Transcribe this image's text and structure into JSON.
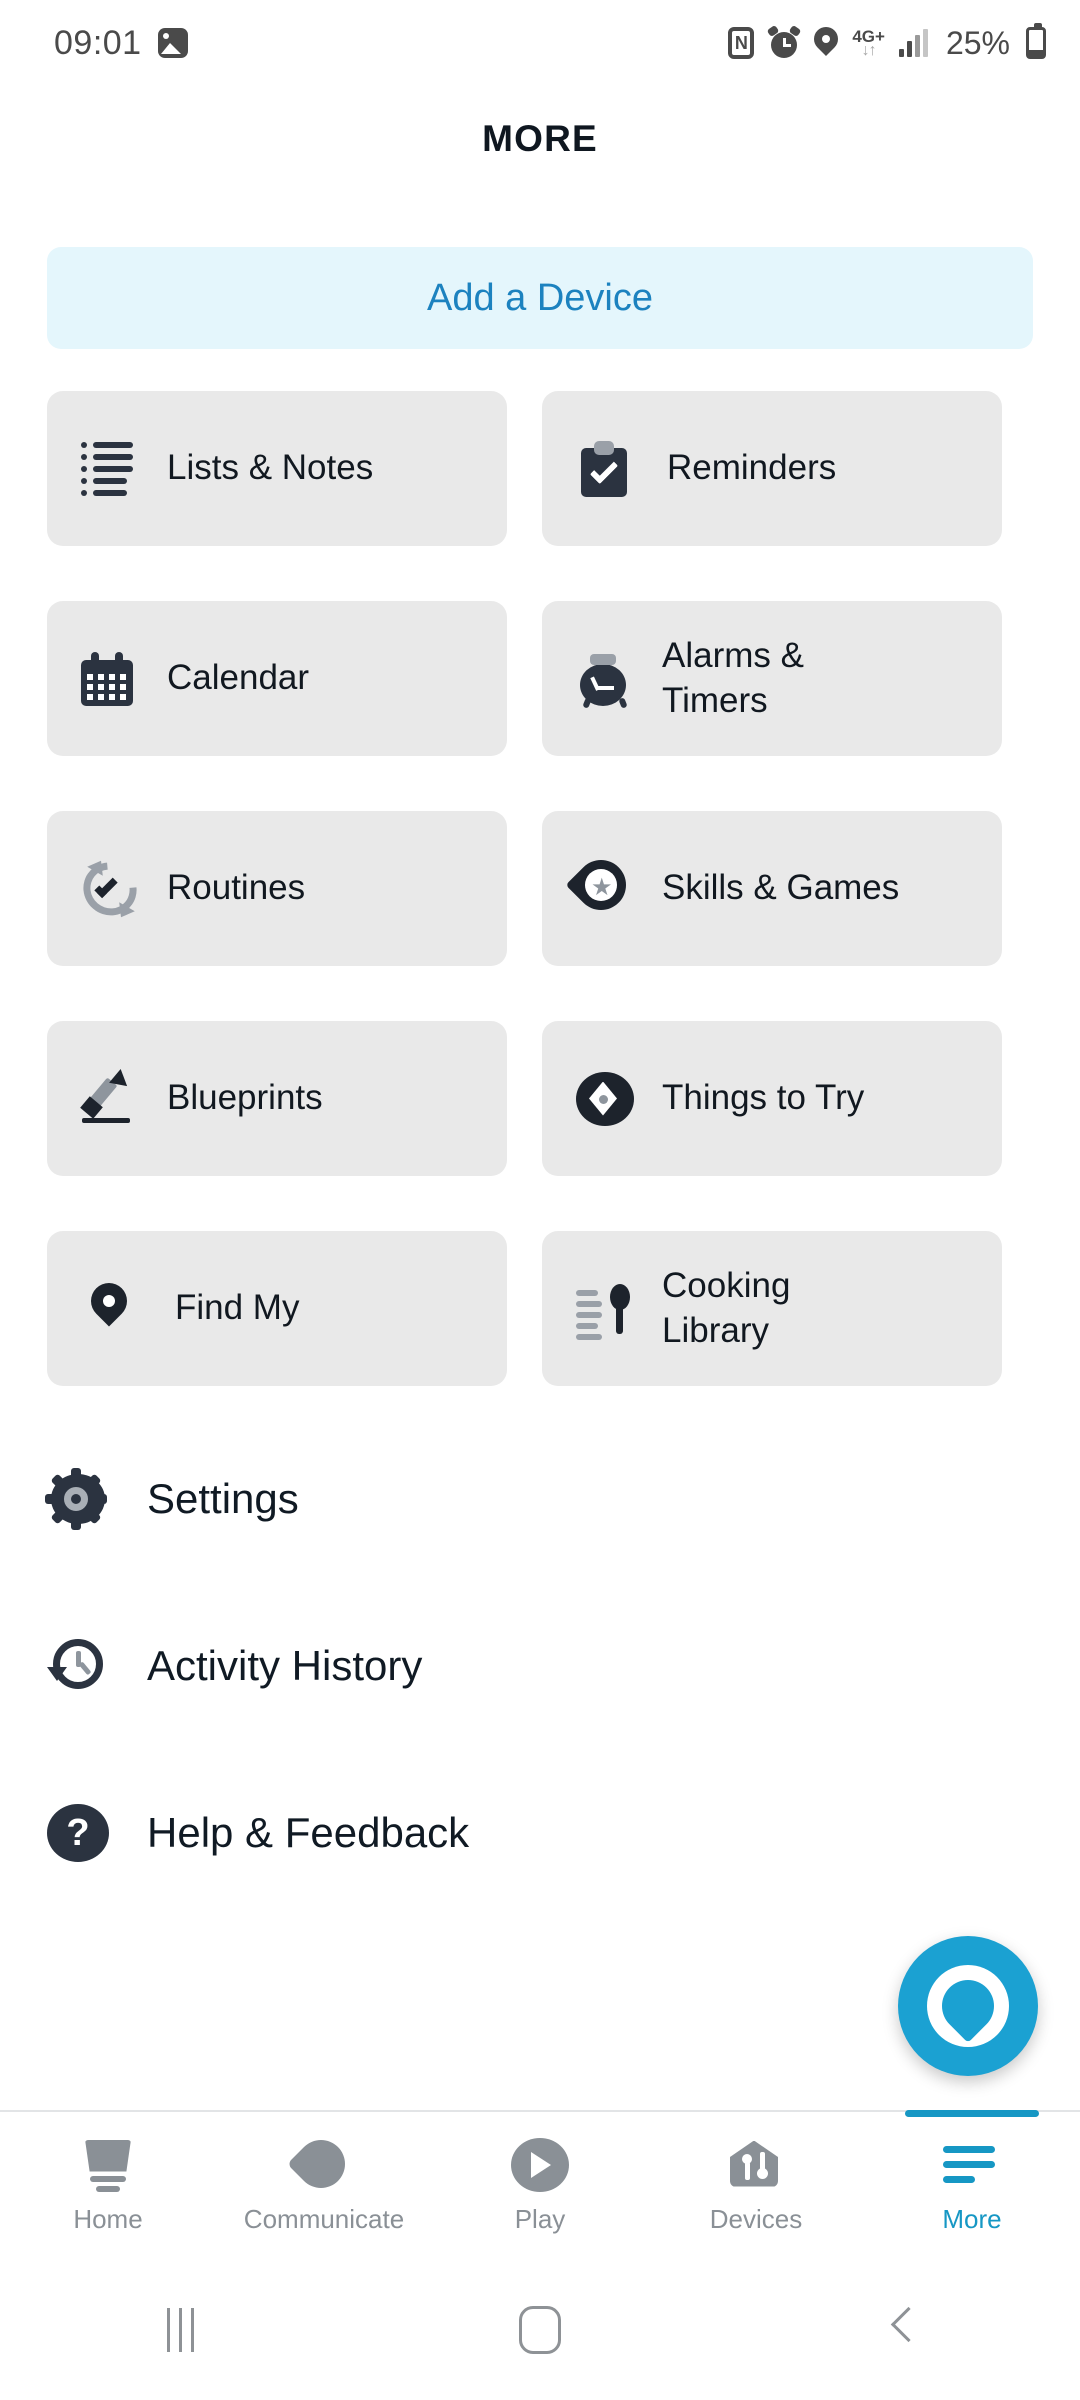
{
  "status_bar": {
    "time": "09:01",
    "battery_percent": "25%",
    "network": "4G+",
    "icons": [
      "gallery-icon",
      "nfc-icon",
      "alarm-icon",
      "location-pin-icon",
      "network-4g-plus-icon",
      "signal-bars-icon",
      "battery-icon"
    ]
  },
  "header": {
    "title": "MORE"
  },
  "banner": {
    "label": "Add a Device",
    "bg": "#e4f6fc",
    "text_color": "#1c82bf"
  },
  "tiles": [
    {
      "label": "Lists & Notes",
      "icon": "lists-icon"
    },
    {
      "label": "Reminders",
      "icon": "clipboard-check-icon"
    },
    {
      "label": "Calendar",
      "icon": "calendar-icon"
    },
    {
      "label": "Alarms &\nTimers",
      "icon": "alarm-clock-icon"
    },
    {
      "label": "Routines",
      "icon": "routines-refresh-check-icon"
    },
    {
      "label": "Skills & Games",
      "icon": "skills-star-bubble-icon"
    },
    {
      "label": "Blueprints",
      "icon": "pencil-icon"
    },
    {
      "label": "Things to Try",
      "icon": "compass-icon"
    },
    {
      "label": "Find My",
      "icon": "location-pin-icon"
    },
    {
      "label": "Cooking\nLibrary",
      "icon": "spoon-recipe-icon"
    }
  ],
  "menu": [
    {
      "label": "Settings",
      "icon": "gear-icon"
    },
    {
      "label": "Activity History",
      "icon": "clock-history-icon"
    },
    {
      "label": "Help & Feedback",
      "icon": "question-circle-icon"
    }
  ],
  "fab": {
    "name": "alexa-button",
    "color": "#1ba1d2"
  },
  "tabbar": {
    "active_color": "#1697c4",
    "inactive_color": "#8a9096",
    "tabs": [
      {
        "label": "Home",
        "icon": "echo-device-icon",
        "active": false
      },
      {
        "label": "Communicate",
        "icon": "speech-bubble-icon",
        "active": false
      },
      {
        "label": "Play",
        "icon": "play-circle-icon",
        "active": false
      },
      {
        "label": "Devices",
        "icon": "home-devices-icon",
        "active": false
      },
      {
        "label": "More",
        "icon": "hamburger-menu-icon",
        "active": true
      }
    ]
  },
  "system_nav": {
    "recents": "recents-icon",
    "home": "home-icon",
    "back": "back-icon"
  }
}
